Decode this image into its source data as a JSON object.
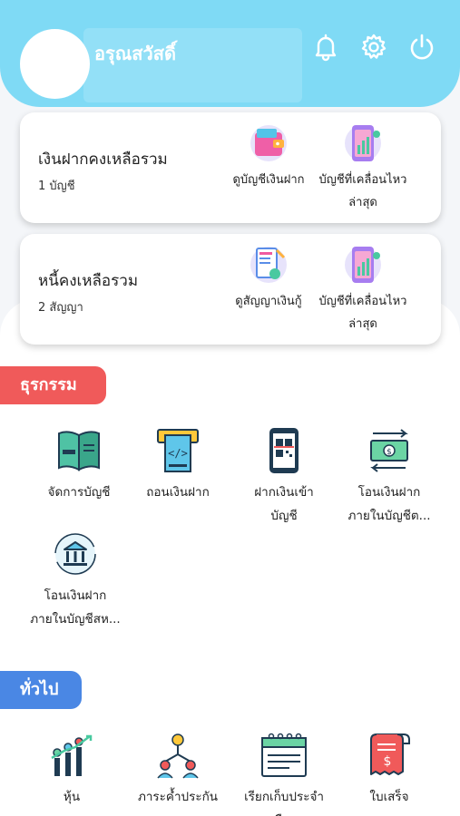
{
  "header": {
    "user_name": "อรุณสวัสดิ์",
    "icons": [
      "bell-icon",
      "gear-icon",
      "power-icon"
    ]
  },
  "deposit_card": {
    "title": "เงินฝากคงเหลือรวม",
    "subtitle": "1 บัญชี",
    "actions": [
      {
        "label": "ดูบัญชีเงินฝาก",
        "icon": "wallet-icon"
      },
      {
        "label_line1": "บัญชีที่เคลื่อนไหว",
        "label_line2": "ล่าสุด",
        "icon": "phone-chart-icon"
      }
    ]
  },
  "loan_card": {
    "title": "หนี้คงเหลือรวม",
    "subtitle": "2 สัญญา",
    "actions": [
      {
        "label": "ดูสัญญาเงินกู้",
        "icon": "contract-icon"
      },
      {
        "label_line1": "บัญชีที่เคลื่อนไหว",
        "label_line2": "ล่าสุด",
        "icon": "phone-chart-icon"
      }
    ]
  },
  "transactions": {
    "tag": "ธุรกรรม",
    "items": [
      {
        "line1": "จัดการบัญชี",
        "line2": "",
        "icon": "account-book-icon"
      },
      {
        "line1": "ถอนเงินฝาก",
        "line2": "",
        "icon": "atm-withdraw-icon"
      },
      {
        "line1": "ฝากเงินเข้า",
        "line2": "บัญชี",
        "icon": "qr-phone-icon"
      },
      {
        "line1": "โอนเงินฝาก",
        "line2": "ภายในบัญชีต...",
        "icon": "money-transfer-icon"
      },
      {
        "line1": "โอนเงินฝาก",
        "line2": "ภายในบัญชีสห...",
        "icon": "bank-transfer-icon"
      }
    ]
  },
  "general": {
    "tag": "ทั่วไป",
    "items": [
      {
        "line1": "หุ้น",
        "line2": "",
        "icon": "stock-chart-icon"
      },
      {
        "line1": "ภาระค้ำประกัน",
        "line2": "",
        "icon": "guarantor-people-icon"
      },
      {
        "line1": "เรียกเก็บประจำ",
        "line2": "เดือน",
        "icon": "calendar-bill-icon"
      },
      {
        "line1": "ใบเสร็จ",
        "line2": "",
        "icon": "receipt-icon"
      }
    ]
  },
  "colors": {
    "header": "#7fdaf5",
    "tag_red": "#f05a5a",
    "tag_blue": "#4a87e4"
  }
}
